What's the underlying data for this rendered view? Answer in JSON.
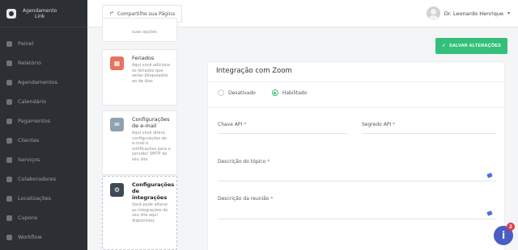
{
  "brand": {
    "line1": "Agendamento",
    "line2": "Link"
  },
  "sidebar": {
    "items": [
      {
        "label": "Painel",
        "icon": "dashboard-icon"
      },
      {
        "label": "Relatório",
        "icon": "report-icon"
      },
      {
        "label": "Agendamentos",
        "icon": "calendar-icon"
      },
      {
        "label": "Calendário",
        "icon": "calendar-grid-icon"
      },
      {
        "label": "Pagamentos",
        "icon": "payment-icon"
      },
      {
        "label": "Clientes",
        "icon": "clients-icon"
      },
      {
        "label": "Serviços",
        "icon": "services-icon"
      },
      {
        "label": "Colaboradores",
        "icon": "staff-icon"
      },
      {
        "label": "Localizações",
        "icon": "location-icon"
      },
      {
        "label": "Cupons",
        "icon": "coupon-icon"
      },
      {
        "label": "Workflow",
        "icon": "workflow-icon"
      }
    ]
  },
  "topbar": {
    "share_label": "Compartilhe sua Página",
    "user_name": "Dr. Leonardo Henrique"
  },
  "integrations": [
    {
      "title": "",
      "desc": "suas opções",
      "icon": "integration-icon",
      "color": "#9aa0a6"
    },
    {
      "title": "Feriados",
      "desc": "Aqui você adiciona os feriados que serão bloqueados ao de dias",
      "icon": "holiday-calendar-icon",
      "color": "#e8725e"
    },
    {
      "title": "Configurações de e-mail",
      "desc": "Aqui você altera configurações de e-mail e notificações para o servidor SMTP do seu site",
      "icon": "email-settings-icon",
      "color": "#8ea2b1"
    },
    {
      "title": "Configurações de integrações",
      "desc": "Você pode alterar as integrações do seu site aqui disponíveis",
      "icon": "integrations-settings-icon",
      "color": "#3d4a56"
    }
  ],
  "main": {
    "save_label": "SALVAR ALTERAÇÕES",
    "panel_title": "Integração com Zoom",
    "radio_off": "Desativado",
    "radio_on": "Habilitado",
    "field_api_key": "Chave API",
    "field_api_secret": "Segredo API",
    "field_topic": "Descrição do tópico",
    "field_meeting": "Descrição da reunião",
    "required_mark": "*"
  },
  "help": {
    "label": "i",
    "badge": "2"
  }
}
